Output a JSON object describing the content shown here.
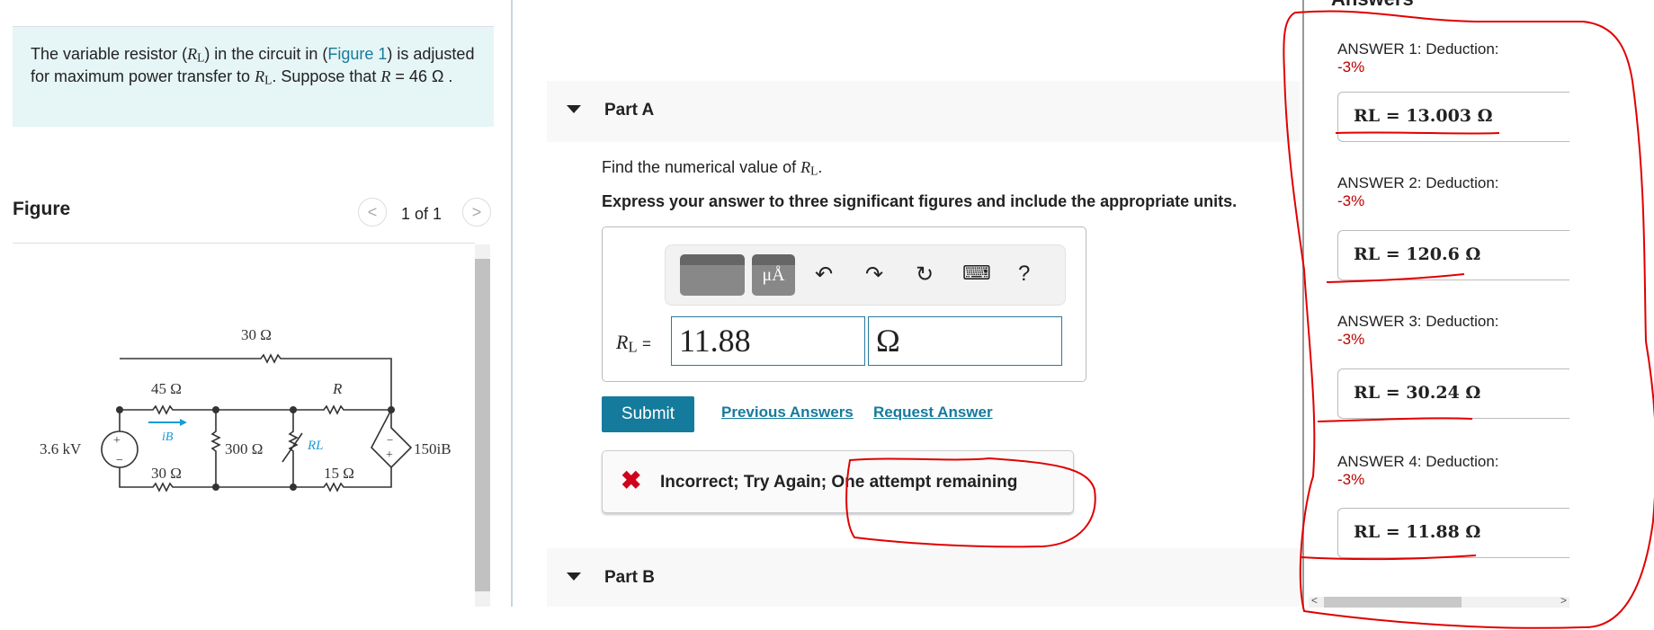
{
  "problem": {
    "text_1": "The variable resistor (",
    "rl": "R",
    "rl_sub": "L",
    "text_2": ") in the circuit in (",
    "figure_link": "Figure 1",
    "text_3": ") is adjusted for maximum power transfer to ",
    "text_4": ". Suppose that ",
    "r_var": "R",
    "text_5": " = 46  Ω ."
  },
  "figure": {
    "label": "Figure",
    "pager": "1 of 1",
    "prev_icon": "chevron-left-icon",
    "next_icon": "chevron-right-icon",
    "circuit": {
      "top_resistor": "30 Ω",
      "r45": "45 Ω",
      "r_var": "R",
      "source": "3.6 kV",
      "current": "iB",
      "r300": "300 Ω",
      "rl": "RL",
      "dep_source": "150iB",
      "r30_bottom": "30 Ω",
      "r15": "15 Ω"
    }
  },
  "part_a": {
    "title": "Part A",
    "find_text": "Find the numerical value of ",
    "express_text": "Express your answer to three significant figures and include the appropriate units.",
    "toolbar": [
      "templates-icon",
      "units-icon",
      "undo-icon",
      "redo-icon",
      "reset-icon",
      "keyboard-icon",
      "help-icon"
    ],
    "units_label": "μÅ",
    "help_label": "?",
    "rl_label": "RL =",
    "value": "11.88",
    "unit": "Ω",
    "submit": "Submit",
    "previous_answers": "Previous Answers",
    "request_answer": "Request Answer",
    "feedback": "Incorrect; Try Again; One attempt remaining",
    "feedback_color": "#d0021b"
  },
  "part_b": {
    "title": "Part B"
  },
  "answers_panel": {
    "heading": "Answers",
    "items": [
      {
        "label": "ANSWER 1: Deduction:",
        "deduction": "-3%",
        "expr": "RL =  13.003 Ω"
      },
      {
        "label": "ANSWER 2: Deduction:",
        "deduction": "-3%",
        "expr": "RL =  120.6 Ω"
      },
      {
        "label": "ANSWER 3: Deduction:",
        "deduction": "-3%",
        "expr": "RL =  30.24 Ω"
      },
      {
        "label": "ANSWER 4: Deduction:",
        "deduction": "-3%",
        "expr": "RL =  11.88 Ω"
      }
    ]
  },
  "colors": {
    "accent": "#157b9c",
    "annotation": "#e00000",
    "deduction": "#b00000"
  }
}
